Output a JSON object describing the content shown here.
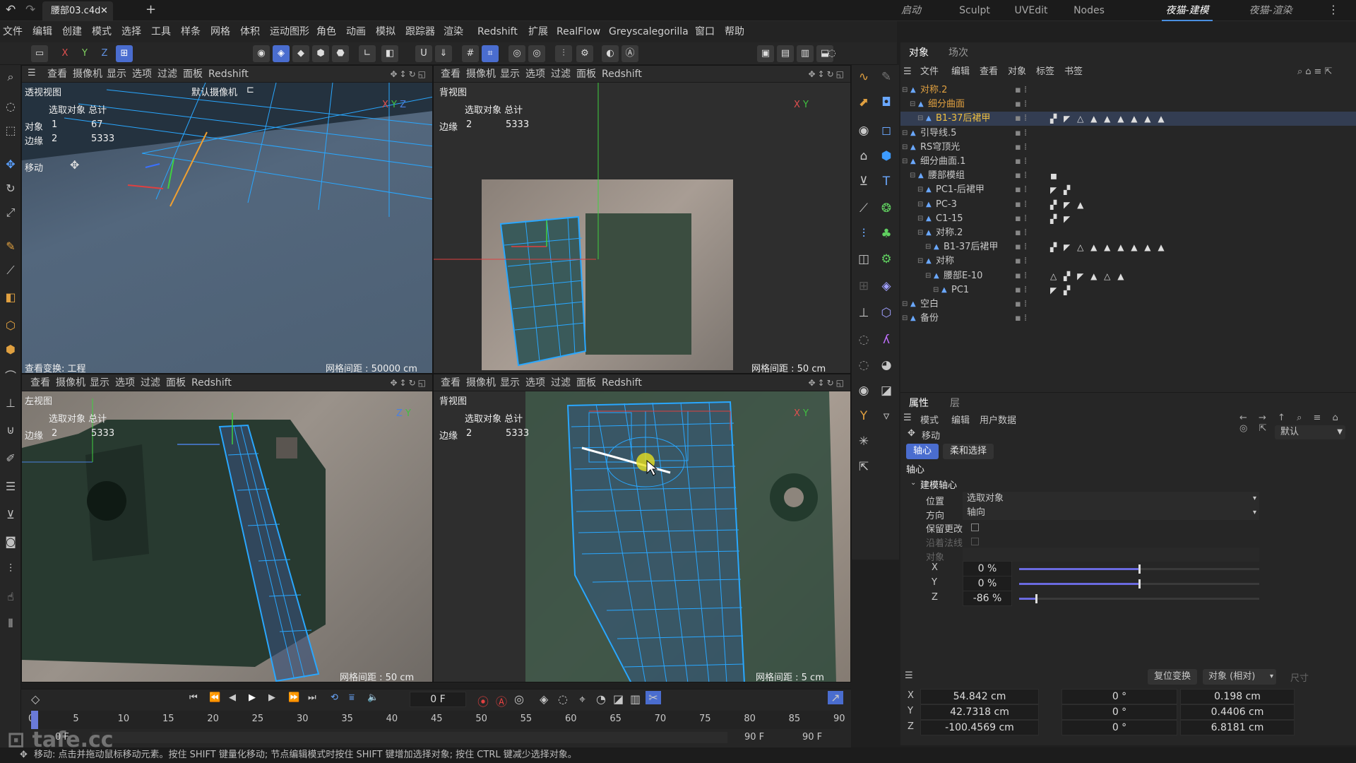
{
  "titlebar": {
    "file_tab": "腰部03.c4d *",
    "workspaces": [
      "启动",
      "Sculpt",
      "UVEdit",
      "Nodes",
      "夜猫-建模",
      "夜猫-渲染"
    ],
    "active_workspace": "夜猫-建模"
  },
  "menubar": [
    "文件",
    "编辑",
    "创建",
    "模式",
    "选择",
    "工具",
    "样条",
    "网格",
    "体积",
    "运动图形",
    "角色",
    "动画",
    "模拟",
    "跟踪器",
    "渲染",
    "Redshift",
    "扩展",
    "RealFlow",
    "Greyscalegorilla",
    "窗口",
    "帮助"
  ],
  "toolbar": {
    "axes": [
      "X",
      "Y",
      "Z"
    ]
  },
  "viewport_menu": [
    "查看",
    "摄像机",
    "显示",
    "选项",
    "过滤",
    "面板",
    "Redshift"
  ],
  "viewports": [
    {
      "name": "透视视图",
      "camera": "默认摄像机",
      "hud_header": "选取对象 总计",
      "rows": [
        [
          "对象",
          "1",
          "67"
        ],
        [
          "边缘",
          "2",
          "5333"
        ]
      ],
      "tool": "移动",
      "footer_left": "查看变换: 工程",
      "grid": "网格间距 : 50000 cm"
    },
    {
      "name": "背视图",
      "hud_header": "选取对象 总计",
      "rows": [
        [
          "边缘",
          "2",
          "5333"
        ]
      ],
      "grid": "网格间距 : 50 cm"
    },
    {
      "name": "左视图",
      "hud_header": "选取对象 总计",
      "rows": [
        [
          "边缘",
          "2",
          "5333"
        ]
      ],
      "grid": "网格间距 : 50 cm"
    },
    {
      "name": "背视图",
      "hud_header": "选取对象 总计",
      "rows": [
        [
          "边缘",
          "2",
          "5333"
        ]
      ],
      "grid": "网格间距 : 5 cm"
    }
  ],
  "objects_panel": {
    "tabs": [
      "对象",
      "场次"
    ],
    "menu": [
      "文件",
      "编辑",
      "查看",
      "对象",
      "标签",
      "书签"
    ],
    "items": [
      {
        "label": "对称.2",
        "depth": 0,
        "color": "#e0a040",
        "tags": ""
      },
      {
        "label": "细分曲面",
        "depth": 1,
        "color": "#e0a040",
        "tags": ""
      },
      {
        "label": "B1-37后裙甲",
        "depth": 2,
        "color": "#f0c040",
        "tags": "▞ ◤ △ ▲ ▲ ▲ ▲ ▲ ▲",
        "selected": true
      },
      {
        "label": "引导线.5",
        "depth": 0,
        "color": "#c8c8c8",
        "tags": ""
      },
      {
        "label": "RS穹顶光",
        "depth": 0,
        "color": "#c8c8c8",
        "tags": ""
      },
      {
        "label": "细分曲面.1",
        "depth": 0,
        "color": "#c8c8c8",
        "tags": ""
      },
      {
        "label": "腰部模组",
        "depth": 1,
        "color": "#c8c8c8",
        "tags": "◼"
      },
      {
        "label": "PC1-后裙甲",
        "depth": 2,
        "color": "#c8c8c8",
        "tags": "◤ ▞"
      },
      {
        "label": "PC-3",
        "depth": 2,
        "color": "#c8c8c8",
        "tags": "▞ ◤ ▲"
      },
      {
        "label": "C1-15",
        "depth": 2,
        "color": "#c8c8c8",
        "tags": "▞ ◤"
      },
      {
        "label": "对称.2",
        "depth": 2,
        "color": "#c8c8c8",
        "tags": ""
      },
      {
        "label": "B1-37后裙甲",
        "depth": 3,
        "color": "#c8c8c8",
        "tags": "▞ ◤ △ ▲ ▲ ▲ ▲ ▲ ▲"
      },
      {
        "label": "对称",
        "depth": 2,
        "color": "#c8c8c8",
        "tags": ""
      },
      {
        "label": "腰部E-10",
        "depth": 3,
        "color": "#c8c8c8",
        "tags": "△ ▞ ◤ ▲ △ ▲"
      },
      {
        "label": "PC1",
        "depth": 4,
        "color": "#c8c8c8",
        "tags": "◤ ▞"
      },
      {
        "label": "空白",
        "depth": 0,
        "color": "#c8c8c8",
        "tags": ""
      },
      {
        "label": "备份",
        "depth": 0,
        "color": "#c8c8c8",
        "tags": ""
      }
    ]
  },
  "attributes": {
    "tabs": [
      "属性",
      "层"
    ],
    "menu": [
      "模式",
      "编辑",
      "用户数据"
    ],
    "tool_name": "移动",
    "preset": "默认",
    "subtabs": [
      "轴心",
      "柔和选择"
    ],
    "section": "轴心",
    "group": "建模轴心",
    "position_label": "位置",
    "position_value": "选取对象",
    "direction_label": "方向",
    "direction_value": "轴向",
    "keep_changes": "保留更改",
    "along_normal": "沿着法线",
    "object_label": "对象",
    "sliders": [
      {
        "axis": "X",
        "value": "0 %",
        "fill": 0.5
      },
      {
        "axis": "Y",
        "value": "0 %",
        "fill": 0.5
      },
      {
        "axis": "Z",
        "value": "-86 %",
        "fill": 0.07
      }
    ]
  },
  "coords": {
    "reset_button": "复位变换",
    "mode": "对象 (相对)",
    "size": "尺寸",
    "rows": [
      {
        "axis": "X",
        "pos": "54.842 cm",
        "rot": "0 °",
        "size": "0.198 cm"
      },
      {
        "axis": "Y",
        "pos": "42.7318 cm",
        "rot": "0 °",
        "size": "0.4406 cm"
      },
      {
        "axis": "Z",
        "pos": "-100.4569 cm",
        "rot": "0 °",
        "size": "6.8181 cm"
      }
    ]
  },
  "timeline": {
    "current_frame": "0 F",
    "ticks": [
      "0",
      "5",
      "10",
      "15",
      "20",
      "25",
      "30",
      "35",
      "40",
      "45",
      "50",
      "55",
      "60",
      "65",
      "70",
      "75",
      "80",
      "85",
      "90"
    ],
    "start_a": "0 F",
    "start_b": "0 F",
    "end_a": "90 F",
    "end_b": "90 F"
  },
  "statusbar": "移动: 点击并拖动鼠标移动元素。按住 SHIFT 键量化移动; 节点编辑模式时按住 SHIFT 键增加选择对象; 按住 CTRL 键减少选择对象。",
  "watermark": "tafe.cc"
}
